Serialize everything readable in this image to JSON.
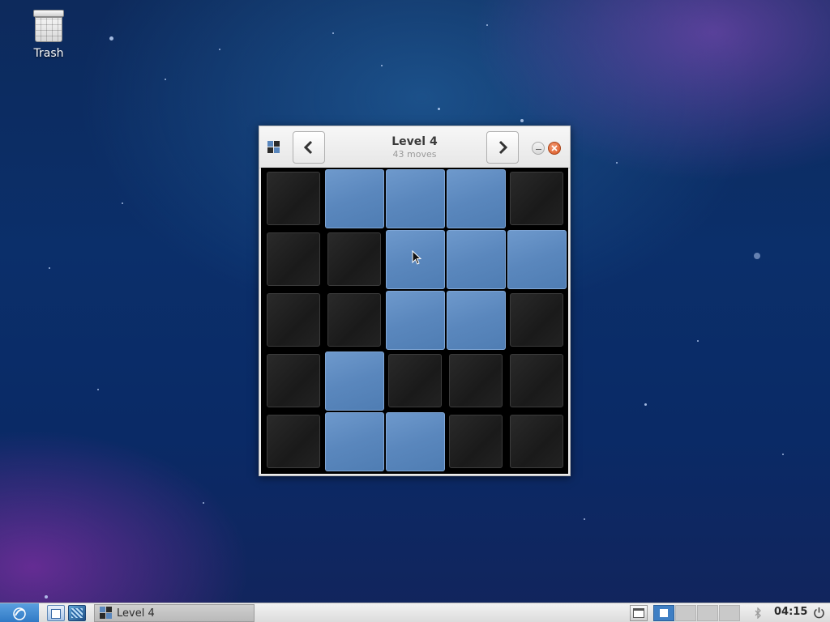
{
  "desktop": {
    "icons": [
      {
        "label": "Trash",
        "icon": "trash-icon"
      }
    ]
  },
  "window": {
    "title": "Level 4",
    "subtitle": "43 moves",
    "app_icon": "lights-off-icon",
    "prev_icon": "chevron-left-icon",
    "next_icon": "chevron-right-icon",
    "minimize_icon": "minimize-icon",
    "close_icon": "close-icon"
  },
  "board": {
    "rows": 5,
    "cols": 5,
    "cells": [
      [
        0,
        1,
        1,
        1,
        0
      ],
      [
        0,
        0,
        1,
        1,
        1
      ],
      [
        0,
        0,
        1,
        1,
        0
      ],
      [
        0,
        1,
        0,
        0,
        0
      ],
      [
        0,
        1,
        1,
        0,
        0
      ]
    ],
    "on_color": "#5a87bd",
    "off_color": "#1e1e1e"
  },
  "taskbar": {
    "start_icon": "start-menu-icon",
    "launchers": [
      "file-manager-icon",
      "desktop-switch-icon"
    ],
    "tasks": [
      {
        "label": "Level 4",
        "icon": "lights-off-icon"
      }
    ],
    "tray": {
      "show_desktop_icon": "window-list-icon",
      "workspaces": 4,
      "active_workspace": 1,
      "bluetooth_icon": "bluetooth-icon",
      "clock": "04:15",
      "power_icon": "power-icon"
    }
  }
}
